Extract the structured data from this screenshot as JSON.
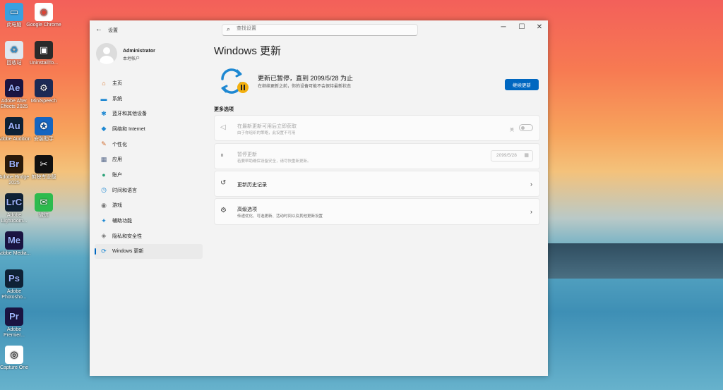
{
  "desktop": {
    "icons": [
      {
        "label": "此电脑",
        "icon": "computer-icon"
      },
      {
        "label": "Google Chrome",
        "icon": "chrome-icon"
      },
      {
        "label": "回收站",
        "icon": "recycle-bin-icon"
      },
      {
        "label": "UninstallTo...",
        "icon": "uninstall-tool-icon"
      },
      {
        "label": "Adobe After Effects 2025",
        "abbr": "Ae",
        "color": "#1a1442"
      },
      {
        "label": "MiniSpeech",
        "icon": "minispeech-icon"
      },
      {
        "label": "Adobe Audition",
        "abbr": "Au",
        "color": "#0f2236"
      },
      {
        "label": "安装助手",
        "icon": "accessibility-icon"
      },
      {
        "label": "Adobe Bridge 2025",
        "abbr": "Br",
        "color": "#2a1a0a"
      },
      {
        "label": "剪映专业版",
        "icon": "capcut-icon"
      },
      {
        "label": "Adobe Lightroom...",
        "abbr": "LrC",
        "color": "#0f2236"
      },
      {
        "label": "微信",
        "icon": "wechat-icon"
      },
      {
        "label": "Adobe Media...",
        "abbr": "Me",
        "color": "#1a1442"
      },
      {
        "label": "Adobe Photosho...",
        "abbr": "Ps",
        "color": "#0f2236"
      },
      {
        "label": "Adobe Premier...",
        "abbr": "Pr",
        "color": "#1a1442"
      },
      {
        "label": "Capture One",
        "icon": "capture-one-icon"
      }
    ]
  },
  "window": {
    "back_icon": "back-arrow-icon",
    "app_title": "设置",
    "search_placeholder": "查找设置",
    "controls": {
      "minimize": "─",
      "maximize": "☐",
      "close": "✕"
    }
  },
  "user": {
    "name": "Administrator",
    "type": "本地帐户"
  },
  "sidebar": {
    "items": [
      {
        "label": "主页",
        "icon": "home-icon",
        "glyph": "⌂",
        "color": "#d9772f"
      },
      {
        "label": "系统",
        "icon": "system-icon",
        "glyph": "▬",
        "color": "#1e88d2"
      },
      {
        "label": "蓝牙和其他设备",
        "icon": "bluetooth-icon",
        "glyph": "✱",
        "color": "#1e88d2"
      },
      {
        "label": "网络和 Internet",
        "icon": "network-icon",
        "glyph": "◆",
        "color": "#1e88d2"
      },
      {
        "label": "个性化",
        "icon": "personalization-icon",
        "glyph": "✎",
        "color": "#d06a2c"
      },
      {
        "label": "应用",
        "icon": "apps-icon",
        "glyph": "▦",
        "color": "#5a6b8c"
      },
      {
        "label": "账户",
        "icon": "accounts-icon",
        "glyph": "●",
        "color": "#2da37a"
      },
      {
        "label": "时间和语言",
        "icon": "time-language-icon",
        "glyph": "◷",
        "color": "#1e88d2"
      },
      {
        "label": "游戏",
        "icon": "gaming-icon",
        "glyph": "◉",
        "color": "#777777"
      },
      {
        "label": "辅助功能",
        "icon": "accessibility-icon",
        "glyph": "✦",
        "color": "#1e88d2"
      },
      {
        "label": "隐私和安全性",
        "icon": "shield-icon",
        "glyph": "◈",
        "color": "#777777"
      },
      {
        "label": "Windows 更新",
        "icon": "windows-update-icon",
        "glyph": "⟳",
        "color": "#1e88d2",
        "active": true
      }
    ]
  },
  "main": {
    "title": "Windows 更新",
    "status_title": "更新已暂停，直到 2099/5/28 为止",
    "status_sub": "在继续更新之前，你的设备可能不会保持最新状态",
    "continue_button": "继续更新",
    "more_options_label": "更多选项",
    "cards": [
      {
        "title": "在最新更新可用后立即获取",
        "subtitle": "由于你组织的策略，此设置不可用",
        "icon": "megaphone-icon",
        "glyph": "◁",
        "toggle_label": "关",
        "disabled": true
      },
      {
        "title": "暂停更新",
        "subtitle": "若要帮助确保设备安全，请尽快重新更新。",
        "icon": "pause-icon",
        "glyph": "⏸",
        "date": "2099/5/28",
        "disabled": true
      },
      {
        "title": "更新历史记录",
        "subtitle": "",
        "icon": "history-icon",
        "glyph": "↺"
      },
      {
        "title": "高级选项",
        "subtitle": "传递优化、可选更新、活动时间以及其他更新设置",
        "icon": "gears-icon",
        "glyph": "⚙"
      }
    ]
  },
  "accent_color": "#0067c0"
}
